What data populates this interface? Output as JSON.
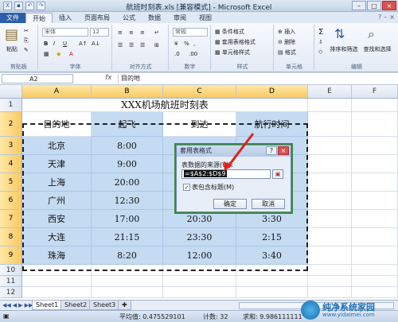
{
  "window": {
    "title": "航班时刻表.xls [兼容模式] - Microsoft Excel"
  },
  "ribbon": {
    "tabs": [
      "文件",
      "开始",
      "插入",
      "页面布局",
      "公式",
      "数据",
      "审阅",
      "视图"
    ],
    "active_tab": "开始",
    "font_name": "宋体",
    "font_size": "12",
    "number_format": "常规",
    "conditional_format_label": "条件格式",
    "table_format_label": "套用表格格式",
    "cell_style_label": "单元格样式",
    "insert_label": "插入",
    "delete_label": "删除",
    "format_label": "格式",
    "sort_filter_label": "排序和筛选",
    "find_select_label": "查找和选择",
    "paste_label": "粘贴",
    "groups": {
      "clipboard": "剪贴板",
      "font": "字体",
      "alignment": "对齐方式",
      "number": "数字",
      "styles": "样式",
      "cells": "单元格",
      "editing": "编辑"
    }
  },
  "formula_bar": {
    "name_box": "A2",
    "fx": "fx",
    "content": "目的地"
  },
  "sheet": {
    "columns": [
      "A",
      "B",
      "C",
      "D",
      "E",
      "F"
    ],
    "rows": [
      "1",
      "2",
      "3",
      "4",
      "5",
      "6",
      "7",
      "8",
      "9",
      "10",
      "11",
      "12"
    ],
    "title": "XXX机场航班时刻表",
    "headers": [
      "目的地",
      "起飞",
      "到达",
      "航行时间"
    ],
    "data": [
      [
        "北京",
        "8:00",
        "",
        ""
      ],
      [
        "天津",
        "9:00",
        "",
        ""
      ],
      [
        "上海",
        "20:00",
        "",
        ""
      ],
      [
        "广州",
        "12:30",
        "",
        ""
      ],
      [
        "西安",
        "17:00",
        "20:30",
        "3:30"
      ],
      [
        "大连",
        "21:15",
        "23:30",
        "2:15"
      ],
      [
        "珠海",
        "8:20",
        "12:00",
        "3:40"
      ]
    ]
  },
  "dialog": {
    "title": "套用表格式",
    "help": "?",
    "close": "×",
    "source_label": "表数据的来源(W):",
    "range_value": "=$A$2:$D$9",
    "has_headers_label": "表包含标题(M)",
    "has_headers_checked": true,
    "ok_label": "确定",
    "cancel_label": "取消"
  },
  "sheet_tabs": [
    "Sheet1",
    "Sheet2",
    "Sheet3"
  ],
  "active_sheet": "Sheet1",
  "status": {
    "average": "平均值: 0.475529101",
    "count": "计数: 32",
    "sum": "求和: 9.986111111"
  },
  "watermark": {
    "text": "纯净系统家园",
    "sub": "www.yidaimei.com"
  },
  "colors": {
    "selection_fill": "#c5dbf2",
    "header_highlight": "#f9c962",
    "file_tab": "#2a5ea8",
    "arrow": "#e0201c"
  }
}
